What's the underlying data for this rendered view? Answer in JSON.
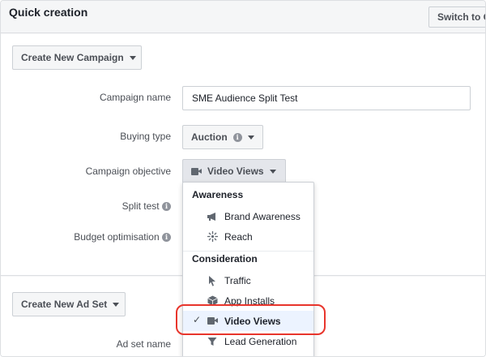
{
  "header": {
    "title": "Quick creation",
    "switch_label": "Switch to G"
  },
  "campaign": {
    "create_button": "Create New Campaign",
    "name_label": "Campaign name",
    "name_value": "SME Audience Split Test",
    "buying_type_label": "Buying type",
    "buying_type_value": "Auction",
    "objective_label": "Campaign objective",
    "objective_value": "Video Views",
    "split_test_label": "Split test",
    "budget_label": "Budget optimisation"
  },
  "menu": {
    "awareness_header": "Awareness",
    "consideration_header": "Consideration",
    "items": [
      {
        "label": "Brand Awareness",
        "icon": "megaphone-icon"
      },
      {
        "label": "Reach",
        "icon": "reach-icon"
      },
      {
        "label": "Traffic",
        "icon": "cursor-icon"
      },
      {
        "label": "App Installs",
        "icon": "box-icon"
      },
      {
        "label": "Video Views",
        "icon": "video-camera-icon",
        "selected": true
      },
      {
        "label": "Lead Generation",
        "icon": "funnel-icon"
      }
    ],
    "check_glyph": "✓"
  },
  "adset": {
    "create_button": "Create New Ad Set",
    "name_label": "Ad set name"
  },
  "colors": {
    "highlight": "#e8352c",
    "selected_bg": "#ecf3ff"
  }
}
